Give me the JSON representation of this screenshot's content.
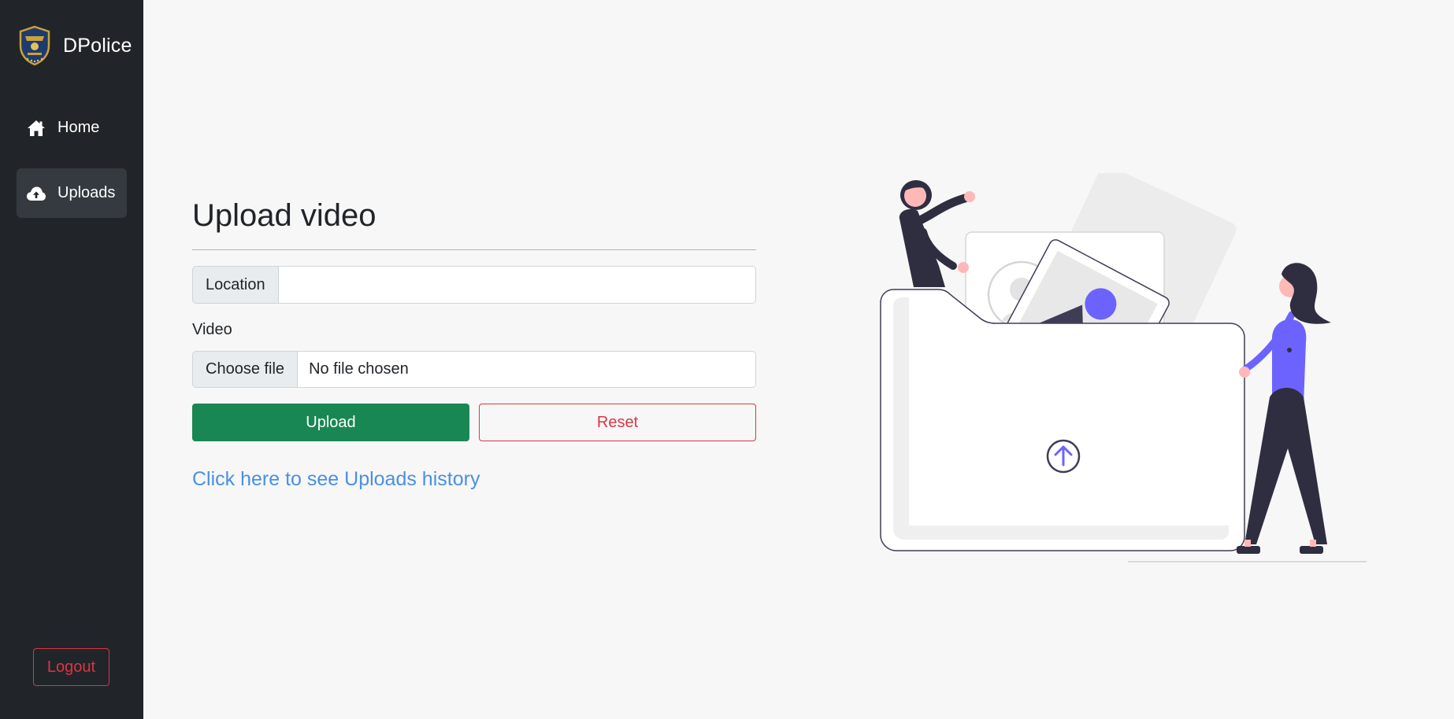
{
  "brand": {
    "name": "DPolice",
    "logo": "police-badge-logo"
  },
  "sidebar": {
    "items": [
      {
        "label": "Home",
        "icon": "home-icon",
        "active": false
      },
      {
        "label": "Uploads",
        "icon": "cloud-upload-icon",
        "active": true
      }
    ],
    "logout_label": "Logout"
  },
  "form": {
    "title": "Upload video",
    "location_label": "Location",
    "location_value": "",
    "video_label": "Video",
    "choose_file_label": "Choose file",
    "file_status": "No file chosen",
    "upload_label": "Upload",
    "reset_label": "Reset",
    "history_link": "Click here to see Uploads history"
  },
  "colors": {
    "sidebar_bg": "#212529",
    "active_item_bg": "#343a40",
    "upload_button": "#198754",
    "danger": "#dc3545",
    "link": "#4a90e2",
    "accent_purple": "#6c63ff"
  }
}
